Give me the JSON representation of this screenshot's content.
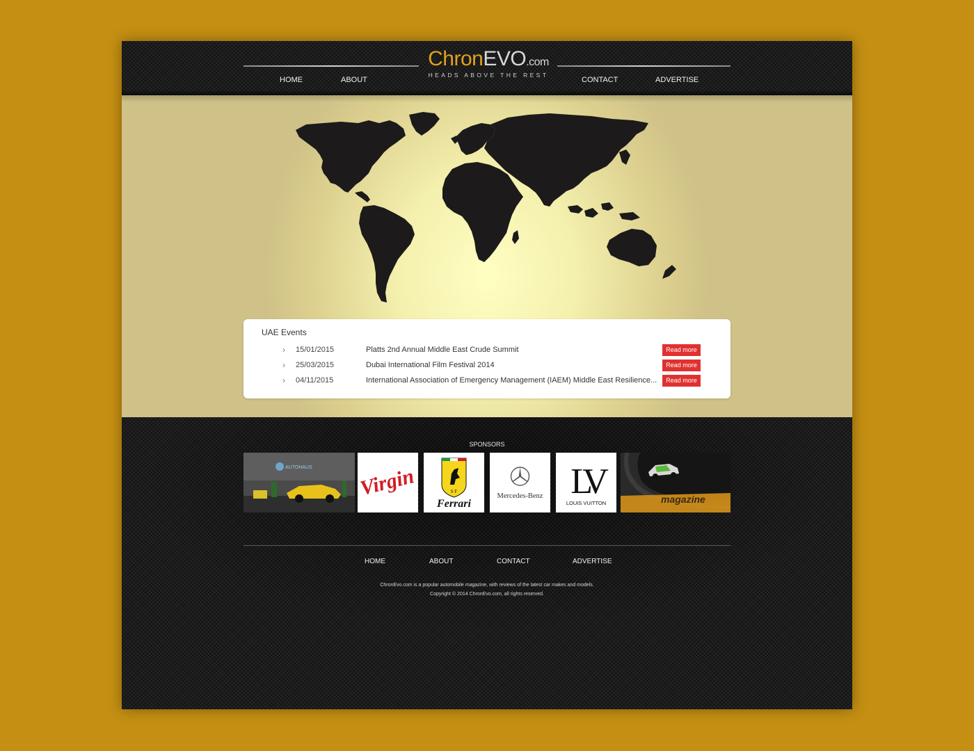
{
  "brand": {
    "logo_chron": "Chron",
    "logo_evo": "EVO",
    "logo_com": ".com",
    "tagline": "HEADS ABOVE THE REST",
    "accent": "#e0a11f"
  },
  "nav": {
    "home": "HOME",
    "about": "ABOUT",
    "contact": "CONTACT",
    "advertise": "ADVERTISE"
  },
  "hero": {
    "image": "world-map"
  },
  "events": {
    "title": "UAE Events",
    "items": [
      {
        "date": "15/01/2015",
        "title": "Platts 2nd Annual Middle East Crude Summit",
        "button": "Read more"
      },
      {
        "date": "25/03/2015",
        "title": "Dubai International Film Festival 2014",
        "button": "Read more"
      },
      {
        "date": "04/11/2015",
        "title": "International Association of Emergency Management (IAEM) Middle East Resilience...",
        "button": "Read more"
      }
    ],
    "button_color": "#e03131"
  },
  "sponsors": {
    "label": "SPONSORS",
    "items": [
      {
        "name": "autohaus-photo",
        "text": "AUTOHAUS"
      },
      {
        "name": "virgin-logo",
        "text": "Virgin"
      },
      {
        "name": "ferrari-logo",
        "text": "Ferrari",
        "badge": "S F"
      },
      {
        "name": "mercedes-benz-logo",
        "text": "Mercedes-Benz"
      },
      {
        "name": "louis-vuitton-logo",
        "text": "LOUIS VUITTON",
        "mark": "LV"
      },
      {
        "name": "magazine-photo",
        "text": "magazine"
      }
    ]
  },
  "footer": {
    "nav": {
      "home": "HOME",
      "about": "ABOUT",
      "contact": "CONTACT",
      "advertise": "ADVERTISE"
    },
    "description": "ChronEvo.com is a popular automobile magazine, with reviews of the latest car makes and models.",
    "copyright": "Copyright © 2014 ChronEvo.com, all rights reserved."
  }
}
